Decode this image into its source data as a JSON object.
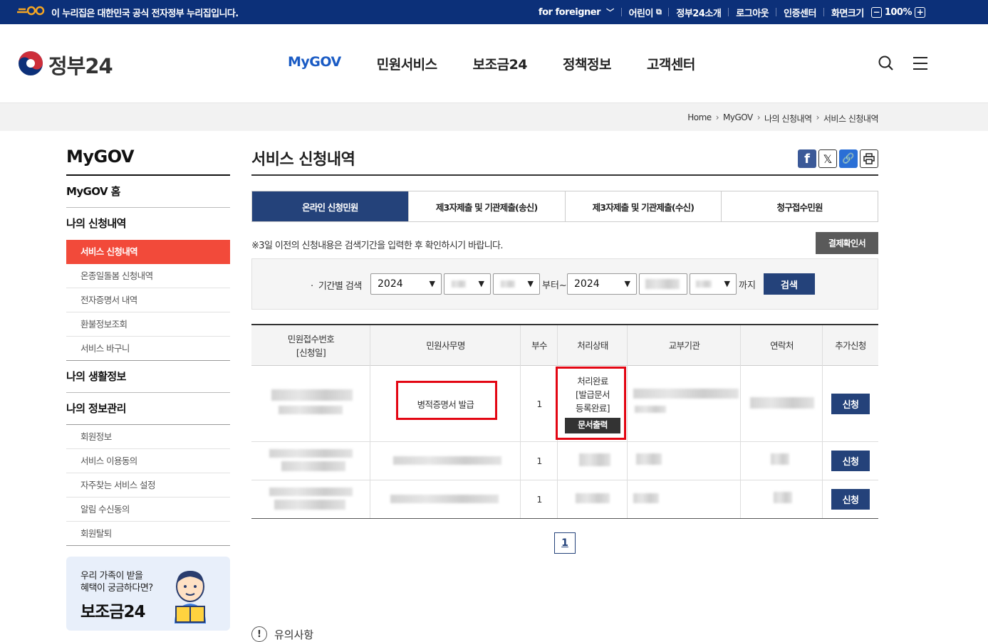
{
  "govbar": {
    "notice": "이 누리집은 대한민국 공식 전자정부 누리집입니다.",
    "links": [
      "for foreigner",
      "어린이",
      "정부24소개",
      "로그아웃",
      "인증센터",
      "화면크기"
    ],
    "zoom": "100%",
    "zoom_minus": "−",
    "zoom_plus": "+"
  },
  "header": {
    "logo_text": "정부24",
    "nav": [
      "MyGOV",
      "민원서비스",
      "보조금24",
      "정책정보",
      "고객센터"
    ]
  },
  "breadcrumb": [
    "Home",
    "MyGOV",
    "나의 신청내역",
    "서비스 신청내역"
  ],
  "sidebar": {
    "title": "MyGOV",
    "home": "MyGOV 홈",
    "section1": "나의 신청내역",
    "section1_items": [
      "서비스 신청내역",
      "온종일돌봄 신청내역",
      "전자증명서 내역",
      "환불정보조회",
      "서비스 바구니"
    ],
    "section2": "나의 생활정보",
    "section3": "나의 정보관리",
    "section3_items": [
      "회원정보",
      "서비스 이용동의",
      "자주찾는 서비스 설정",
      "알림 수신동의",
      "회원탈퇴"
    ],
    "banner_line1": "우리 가족이 받을",
    "banner_line2": "혜택이 궁금하다면?",
    "banner_title": "보조금24"
  },
  "content": {
    "title": "서비스 신청내역",
    "tabs": [
      "온라인 신청민원",
      "제3자제출 및 기관제출(송신)",
      "제3자제출 및 기관제출(수신)",
      "청구접수민원"
    ],
    "notice": "※3일 이전의 신청내용은 검색기간을 입력한 후 확인하시기 바랍니다.",
    "pay_button": "결제확인서",
    "search": {
      "label": "기간별 검색",
      "start_year": "2024",
      "end_year": "2024",
      "from_text": "부터~",
      "to_text": "까지",
      "button": "검색"
    },
    "table": {
      "headers": [
        "민원접수번호\n[신청일]",
        "민원사무명",
        "부수",
        "처리상태",
        "교부기관",
        "연락처",
        "추가신청"
      ],
      "rows": [
        {
          "service_name": "병적증명서 발급",
          "copies": "1",
          "status_l1": "처리완료",
          "status_l2": "[발급문서",
          "status_l3": "등록완료]",
          "print_button": "문서출력",
          "apply": "신청"
        },
        {
          "copies": "1",
          "apply": "신청"
        },
        {
          "copies": "1",
          "apply": "신청"
        }
      ]
    },
    "page": "1",
    "caution": "유의사항"
  }
}
